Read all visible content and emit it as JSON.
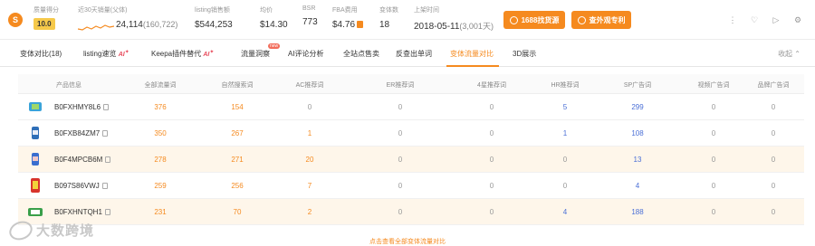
{
  "stats": {
    "score_label": "质量得分",
    "score_value": "10.0",
    "sales_label": "近30天销量(父体)",
    "sales_value": "24,114",
    "sales_parent": "(160,722)",
    "revenue_label": "listing销售额",
    "revenue_value": "$544,253",
    "price_label": "均价",
    "price_value": "$14.30",
    "bsr_label": "BSR",
    "bsr_value": "773",
    "fba_label": "FBA费用",
    "fba_value": "$4.76",
    "variants_label": "变体数",
    "variants_value": "18",
    "listed_label": "上架时间",
    "listed_value": "2018-05-11",
    "listed_days": "(3,001天)"
  },
  "buttons": {
    "source": "1688找货源",
    "patent": "查外观专利"
  },
  "top_icons": [
    "more-icon",
    "heart-icon",
    "video-icon",
    "settings-icon"
  ],
  "tabs": [
    {
      "label": "变体对比(18)",
      "ai": false,
      "new": false
    },
    {
      "label": "listing速览",
      "ai": true,
      "new": false
    },
    {
      "label": "Keepa插件替代",
      "ai": true,
      "new": false
    },
    {
      "label": "流量洞察",
      "ai": false,
      "new": true
    },
    {
      "label": "AI评论分析",
      "ai": false,
      "new": false
    },
    {
      "label": "全站点售卖",
      "ai": false,
      "new": false
    },
    {
      "label": "反查出单词",
      "ai": false,
      "new": false
    },
    {
      "label": "变体流量对比",
      "ai": false,
      "new": false,
      "active": true
    },
    {
      "label": "3D展示",
      "ai": false,
      "new": false
    }
  ],
  "ai_label": "AI",
  "new_label": "new",
  "collapse_label": "收起",
  "table": {
    "headers": [
      "产品信息",
      "全部流量词",
      "自然搜索词",
      "AC推荐词",
      "ER推荐词",
      "4星推荐词",
      "HR推荐词",
      "SP广告词",
      "视频广告词",
      "品牌广告词"
    ],
    "rows": [
      {
        "asin": "B0FXHMY8L6",
        "thumb_color": "#3aa3d9",
        "values": [
          "376",
          "154",
          "0",
          "0",
          "0",
          "5",
          "299",
          "0",
          "0"
        ],
        "highlight": false
      },
      {
        "asin": "B0FXB84ZM7",
        "thumb_color": "#2f6fb8",
        "values": [
          "350",
          "267",
          "1",
          "0",
          "0",
          "1",
          "108",
          "0",
          "0"
        ],
        "highlight": false
      },
      {
        "asin": "B0F4MPCB6M",
        "thumb_color": "#3a6fcf",
        "values": [
          "278",
          "271",
          "20",
          "0",
          "0",
          "0",
          "13",
          "0",
          "0"
        ],
        "highlight": true
      },
      {
        "asin": "B097S86VWJ",
        "thumb_color": "#d8342c",
        "values": [
          "259",
          "256",
          "7",
          "0",
          "0",
          "0",
          "4",
          "0",
          "0"
        ],
        "highlight": false
      },
      {
        "asin": "B0FXHNTQH1",
        "thumb_color": "#3a9f4a",
        "values": [
          "231",
          "70",
          "2",
          "0",
          "0",
          "4",
          "188",
          "0",
          "0"
        ],
        "highlight": true
      }
    ]
  },
  "footer_link": "点击查看全部变体流量对比",
  "watermark": "大数跨境",
  "colors": {
    "accent": "#f58a1f",
    "blue": "#4a6fd6",
    "highlight_row": "#fef6ea"
  }
}
